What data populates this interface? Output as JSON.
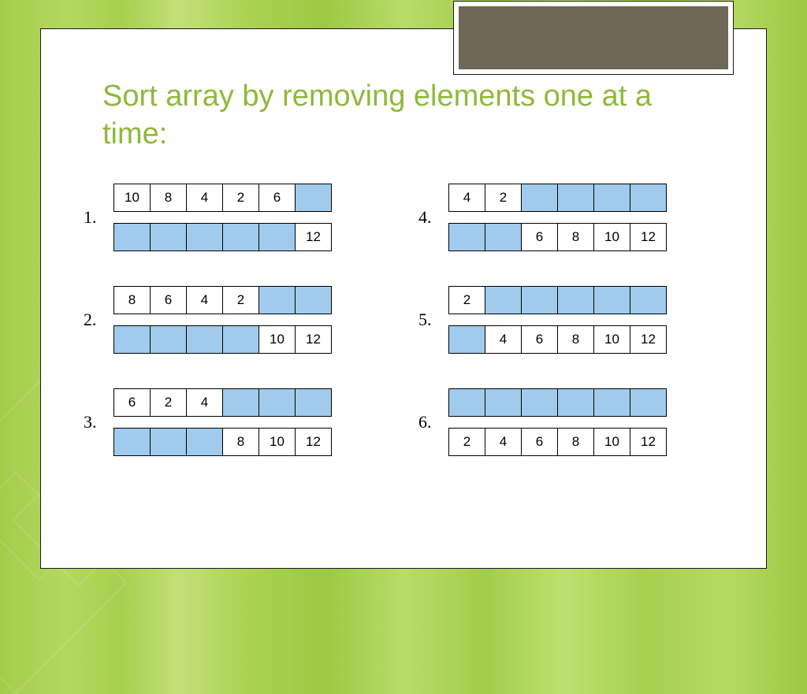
{
  "title": "Sort array by removing elements one at a time:",
  "colors": {
    "title": "#8fb93a",
    "fill": "#a1cbec",
    "corner": "#6f6757"
  },
  "steps": [
    {
      "num": "1.",
      "top": [
        {
          "v": "10"
        },
        {
          "v": "8"
        },
        {
          "v": "4"
        },
        {
          "v": "2"
        },
        {
          "v": "6"
        },
        {
          "v": "",
          "f": true
        }
      ],
      "bottom": [
        {
          "v": "",
          "f": true
        },
        {
          "v": "",
          "f": true
        },
        {
          "v": "",
          "f": true
        },
        {
          "v": "",
          "f": true
        },
        {
          "v": "",
          "f": true
        },
        {
          "v": "12"
        }
      ]
    },
    {
      "num": "2.",
      "top": [
        {
          "v": "8"
        },
        {
          "v": "6"
        },
        {
          "v": "4"
        },
        {
          "v": "2"
        },
        {
          "v": "",
          "f": true
        },
        {
          "v": "",
          "f": true
        }
      ],
      "bottom": [
        {
          "v": "",
          "f": true
        },
        {
          "v": "",
          "f": true
        },
        {
          "v": "",
          "f": true
        },
        {
          "v": "",
          "f": true
        },
        {
          "v": "10"
        },
        {
          "v": "12"
        }
      ]
    },
    {
      "num": "3.",
      "top": [
        {
          "v": "6"
        },
        {
          "v": "2"
        },
        {
          "v": "4"
        },
        {
          "v": "",
          "f": true
        },
        {
          "v": "",
          "f": true
        },
        {
          "v": "",
          "f": true
        }
      ],
      "bottom": [
        {
          "v": "",
          "f": true
        },
        {
          "v": "",
          "f": true
        },
        {
          "v": "",
          "f": true
        },
        {
          "v": "8"
        },
        {
          "v": "10"
        },
        {
          "v": "12"
        }
      ]
    },
    {
      "num": "4.",
      "top": [
        {
          "v": "4"
        },
        {
          "v": "2"
        },
        {
          "v": "",
          "f": true
        },
        {
          "v": "",
          "f": true
        },
        {
          "v": "",
          "f": true
        },
        {
          "v": "",
          "f": true
        }
      ],
      "bottom": [
        {
          "v": "",
          "f": true
        },
        {
          "v": "",
          "f": true
        },
        {
          "v": "6"
        },
        {
          "v": "8"
        },
        {
          "v": "10"
        },
        {
          "v": "12"
        }
      ]
    },
    {
      "num": "5.",
      "top": [
        {
          "v": "2"
        },
        {
          "v": "",
          "f": true
        },
        {
          "v": "",
          "f": true
        },
        {
          "v": "",
          "f": true
        },
        {
          "v": "",
          "f": true
        },
        {
          "v": "",
          "f": true
        }
      ],
      "bottom": [
        {
          "v": "",
          "f": true
        },
        {
          "v": "4"
        },
        {
          "v": "6"
        },
        {
          "v": "8"
        },
        {
          "v": "10"
        },
        {
          "v": "12"
        }
      ]
    },
    {
      "num": "6.",
      "top": [
        {
          "v": "",
          "f": true
        },
        {
          "v": "",
          "f": true
        },
        {
          "v": "",
          "f": true
        },
        {
          "v": "",
          "f": true
        },
        {
          "v": "",
          "f": true
        },
        {
          "v": "",
          "f": true
        }
      ],
      "bottom": [
        {
          "v": "2"
        },
        {
          "v": "4"
        },
        {
          "v": "6"
        },
        {
          "v": "8"
        },
        {
          "v": "10"
        },
        {
          "v": "12"
        }
      ]
    }
  ]
}
